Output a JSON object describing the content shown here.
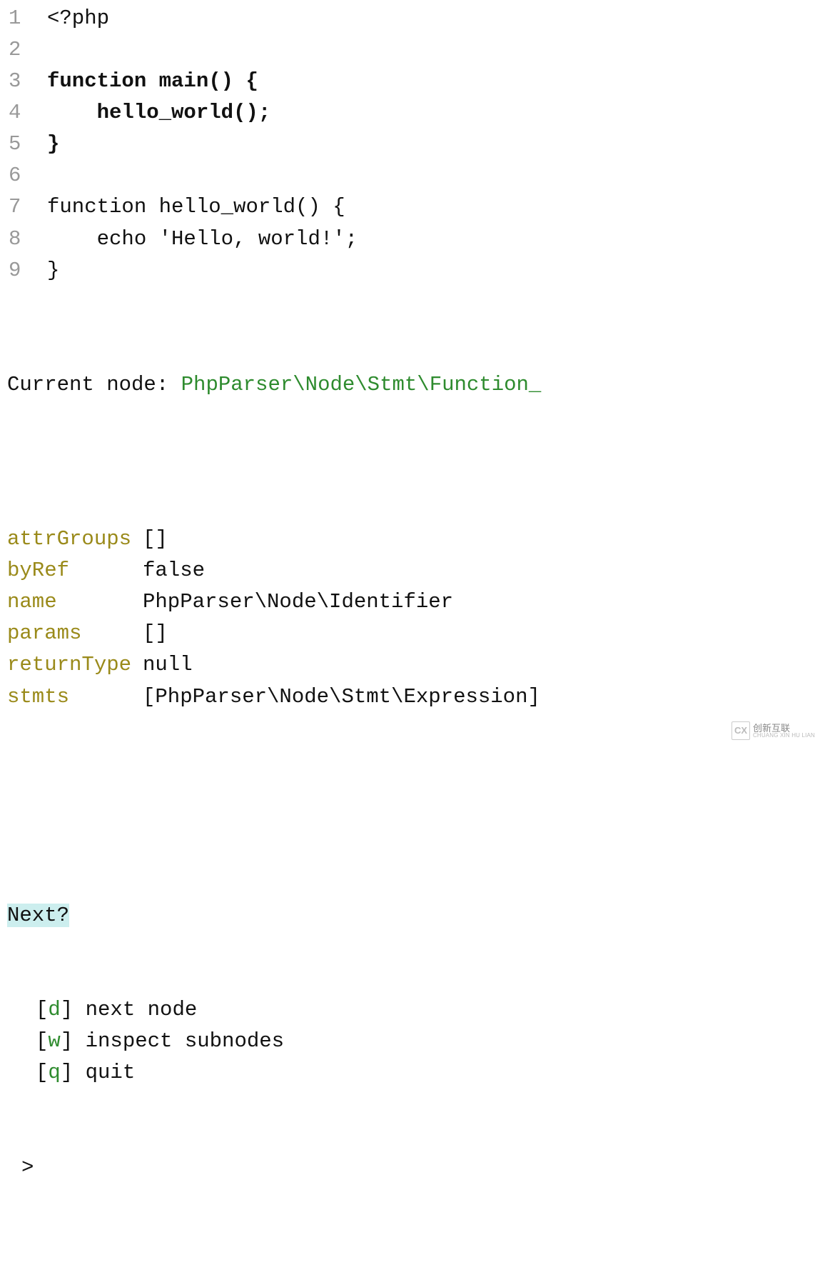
{
  "code": {
    "lines": [
      {
        "n": "1",
        "text": "<?php",
        "bold": false
      },
      {
        "n": "2",
        "text": "",
        "bold": false
      },
      {
        "n": "3",
        "text": "function main() {",
        "bold": true
      },
      {
        "n": "4",
        "text": "    hello_world();",
        "bold": true
      },
      {
        "n": "5",
        "text": "}",
        "bold": true
      },
      {
        "n": "6",
        "text": "",
        "bold": false
      },
      {
        "n": "7",
        "text": "function hello_world() {",
        "bold": false
      },
      {
        "n": "8",
        "text": "    echo 'Hello, world!';",
        "bold": false
      },
      {
        "n": "9",
        "text": "}",
        "bold": false
      }
    ]
  },
  "currentNode": {
    "label": "Current node: ",
    "value": "PhpParser\\Node\\Stmt\\Function_"
  },
  "attributes": [
    {
      "key": "attrGroups",
      "value": "[]"
    },
    {
      "key": "byRef",
      "value": "false"
    },
    {
      "key": "name",
      "value": "PhpParser\\Node\\Identifier"
    },
    {
      "key": "params",
      "value": "[]"
    },
    {
      "key": "returnType",
      "value": "null"
    },
    {
      "key": "stmts",
      "value": "[PhpParser\\Node\\Stmt\\Expression]"
    }
  ],
  "prompt": {
    "question": "Next?",
    "options": [
      {
        "key": "d",
        "label": "next node"
      },
      {
        "key": "w",
        "label": "inspect subnodes"
      },
      {
        "key": "q",
        "label": "quit"
      }
    ],
    "caret": ">"
  },
  "watermark": {
    "logo": "CX",
    "line1": "创新互联",
    "line2": "CHUANG XIN HU LIAN"
  }
}
